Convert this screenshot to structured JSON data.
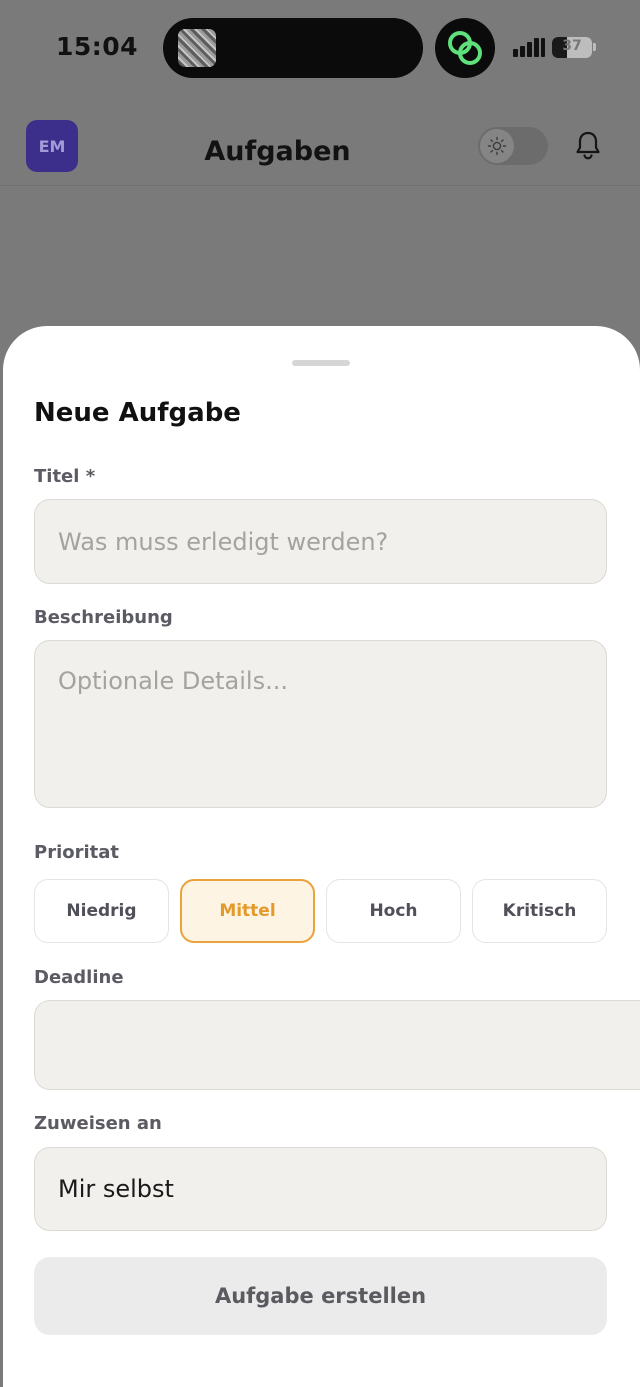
{
  "status_bar": {
    "time": "15:04",
    "battery": "37",
    "battery_level": 0.37
  },
  "header": {
    "avatar_initials": "EM",
    "title": "Aufgaben"
  },
  "sheet": {
    "title": "Neue Aufgabe",
    "fields": {
      "title_label": "Titel *",
      "title_placeholder": "Was muss erledigt werden?",
      "description_label": "Beschreibung",
      "description_placeholder": "Optionale Details...",
      "priority_label": "Prioritat",
      "priorities": [
        "Niedrig",
        "Mittel",
        "Hoch",
        "Kritisch"
      ],
      "selected_priority": "Mittel",
      "deadline_label": "Deadline",
      "deadline_value": "",
      "assign_label": "Zuweisen an",
      "assign_value": "Mir selbst"
    },
    "submit_label": "Aufgabe erstellen"
  },
  "colors": {
    "accent": "#e9a33c",
    "avatar_bg": "#3c2f8c",
    "overlay": "#7a7a7a"
  }
}
